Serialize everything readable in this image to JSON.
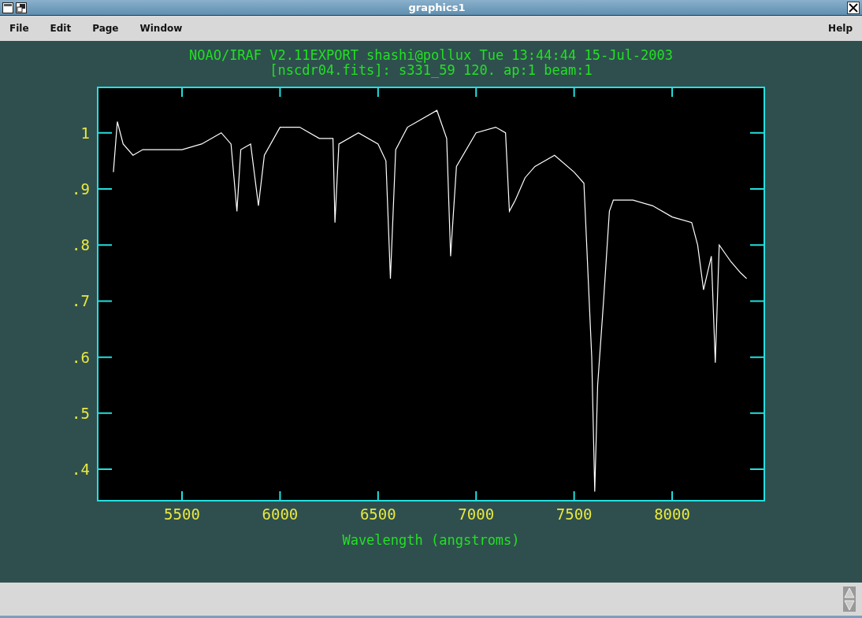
{
  "window": {
    "title": "graphics1"
  },
  "menu": {
    "items": [
      "File",
      "Edit",
      "Page",
      "Window"
    ],
    "help": "Help"
  },
  "plot": {
    "header_lines": [
      "NOAO/IRAF V2.11EXPORT shashi@pollux Tue 13:44:44 15-Jul-2003",
      "[nscdr04.fits]: s331_59 120. ap:1 beam:1"
    ],
    "chart_data": {
      "type": "line",
      "xlabel": "Wavelength (angstroms)",
      "xlim": [
        5070,
        8470
      ],
      "ylim": [
        0.344,
        1.081
      ],
      "xticks": [
        5500,
        6000,
        6500,
        7000,
        7500,
        8000
      ],
      "yticks": [
        {
          "value": 0.4,
          "label": ".4"
        },
        {
          "value": 0.5,
          "label": ".5"
        },
        {
          "value": 0.6,
          "label": ".6"
        },
        {
          "value": 0.7,
          "label": ".7"
        },
        {
          "value": 0.8,
          "label": ".8"
        },
        {
          "value": 0.9,
          "label": ".9"
        },
        {
          "value": 1,
          "label": "1"
        }
      ],
      "x": [
        5150,
        5170,
        5200,
        5250,
        5300,
        5400,
        5500,
        5600,
        5700,
        5750,
        5780,
        5800,
        5850,
        5890,
        5920,
        6000,
        6100,
        6200,
        6270,
        6280,
        6300,
        6400,
        6500,
        6540,
        6563,
        6590,
        6650,
        6700,
        6800,
        6850,
        6870,
        6900,
        7000,
        7100,
        7150,
        7170,
        7200,
        7250,
        7300,
        7400,
        7500,
        7550,
        7590,
        7605,
        7620,
        7650,
        7680,
        7700,
        7800,
        7900,
        8000,
        8100,
        8130,
        8160,
        8200,
        8220,
        8240,
        8300,
        8350,
        8380
      ],
      "series": [
        {
          "color": "#ffffff",
          "values": [
            0.93,
            1.02,
            0.98,
            0.96,
            0.97,
            0.97,
            0.97,
            0.98,
            1.0,
            0.98,
            0.86,
            0.97,
            0.98,
            0.87,
            0.96,
            1.01,
            1.01,
            0.99,
            0.99,
            0.84,
            0.98,
            1.0,
            0.98,
            0.95,
            0.74,
            0.97,
            1.01,
            1.02,
            1.04,
            0.99,
            0.78,
            0.94,
            1.0,
            1.01,
            1.0,
            0.86,
            0.88,
            0.92,
            0.94,
            0.96,
            0.93,
            0.91,
            0.6,
            0.36,
            0.55,
            0.7,
            0.86,
            0.88,
            0.88,
            0.87,
            0.85,
            0.84,
            0.8,
            0.72,
            0.78,
            0.59,
            0.8,
            0.77,
            0.75,
            0.74
          ]
        }
      ]
    }
  }
}
